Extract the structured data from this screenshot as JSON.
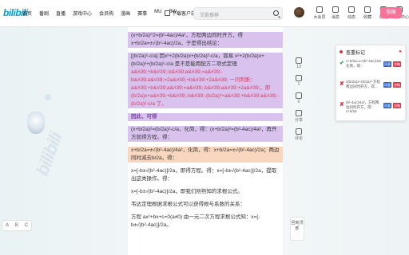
{
  "header": {
    "logo": "bilibili",
    "nav": [
      "首页",
      "番剧",
      "直播",
      "游戏中心",
      "会员购",
      "漫画",
      "赛事",
      "MU",
      "BW"
    ],
    "download_label": "下载客户端",
    "search_placeholder": "艾歌推荐",
    "right_icons": [
      "大会员",
      "消息",
      "动态",
      "收藏",
      "历史",
      "创作中心"
    ],
    "upload_label": "投稿"
  },
  "article": {
    "paragraphs": [
      "(x+b/2a)^2=(b²-4ac)/4a²，方程两边同时开方，得x+b/2a=±√(b²-4ac)/2a，于是得出结论：",
      "[(b/2a)²-c/a] 因x²+2(b/2a)x+(b/2a)²-c/a，容易 x²+2(b/2a)x+(b/2a)²+(b/2a)²-c/a 是不是能用配方二项式定理",
      "a&#39;+b&#39;-b&#39;a&#39;=a&#39;-b&#39;a&#39;=2a&#39;+b&#39;+2a&#39; 一问判断：a&#39;+b&#39;a&#39;=a&#39;-b&#39;a&#39;+2a&#39;，即(b/2a)x+a&#39;+b&#39;-b&#39;-(b/2a)²+a&#39;+b&#39;a&#39;-(b/2a)²-c/a 了。",
      "因此，可得",
      "(x+b/2a)²=(b/2a)²-c/a，化简，得：(x+b/2a)²=(b²-4ac)/4a²，再开方就得方程。得：",
      "x+b/2a=±√(b²-4ac)/4a²，化简，得：x+b/2a=±√(b²-4ac)/2a；两边同时减去b/2a，得：",
      "x=[-b±√(b²-4ac)]/2a，即得方程。得：x=[-b±√(b²-4ac)]/2a，提取出这类操作。得：",
      "x=[-b±√(b²-4ac)]/2a，即我们所熟知的求根公式。",
      "韦达定理根据求根公式可以获得根与系数的关系：",
      "方程 ax²+bx+c=0(a≠0) 由一元二次方程求根公式知：x=[-b±√(b²-4ac)]/2a。"
    ]
  },
  "sidebar": {
    "items": [
      "点赞",
      "13",
      "投币",
      "收藏",
      "1",
      "分享",
      "0",
      "评论"
    ],
    "box_label": "回到顶部"
  },
  "panel": {
    "title": "查重标记",
    "items": [
      {
        "mark": "✔",
        "text": "x+b/2a=±√(b²-4ac)/4a²，化简，得：",
        "apply": "同意",
        "remove": "忽略"
      },
      {
        "mark": "✘",
        "text": "2(b/2a)x+(b/2a)²-方程两边同时开方，得...",
        "apply": "同意",
        "remove": "忽略"
      },
      {
        "mark": "✘",
        "text": "(b²-4ac)/4a²，方程两边同时开方，得：x+b/2a",
        "apply": "同意",
        "remove": "忽略"
      }
    ],
    "colors": {
      "accent": "#e7343f",
      "apply": "#2a63c9",
      "remove": "#e0344b",
      "highlight": "#d9c3ee",
      "orange_highlight": "#f9d7bf"
    }
  },
  "left_tool": {
    "labels": [
      "A",
      "B",
      "C"
    ]
  }
}
